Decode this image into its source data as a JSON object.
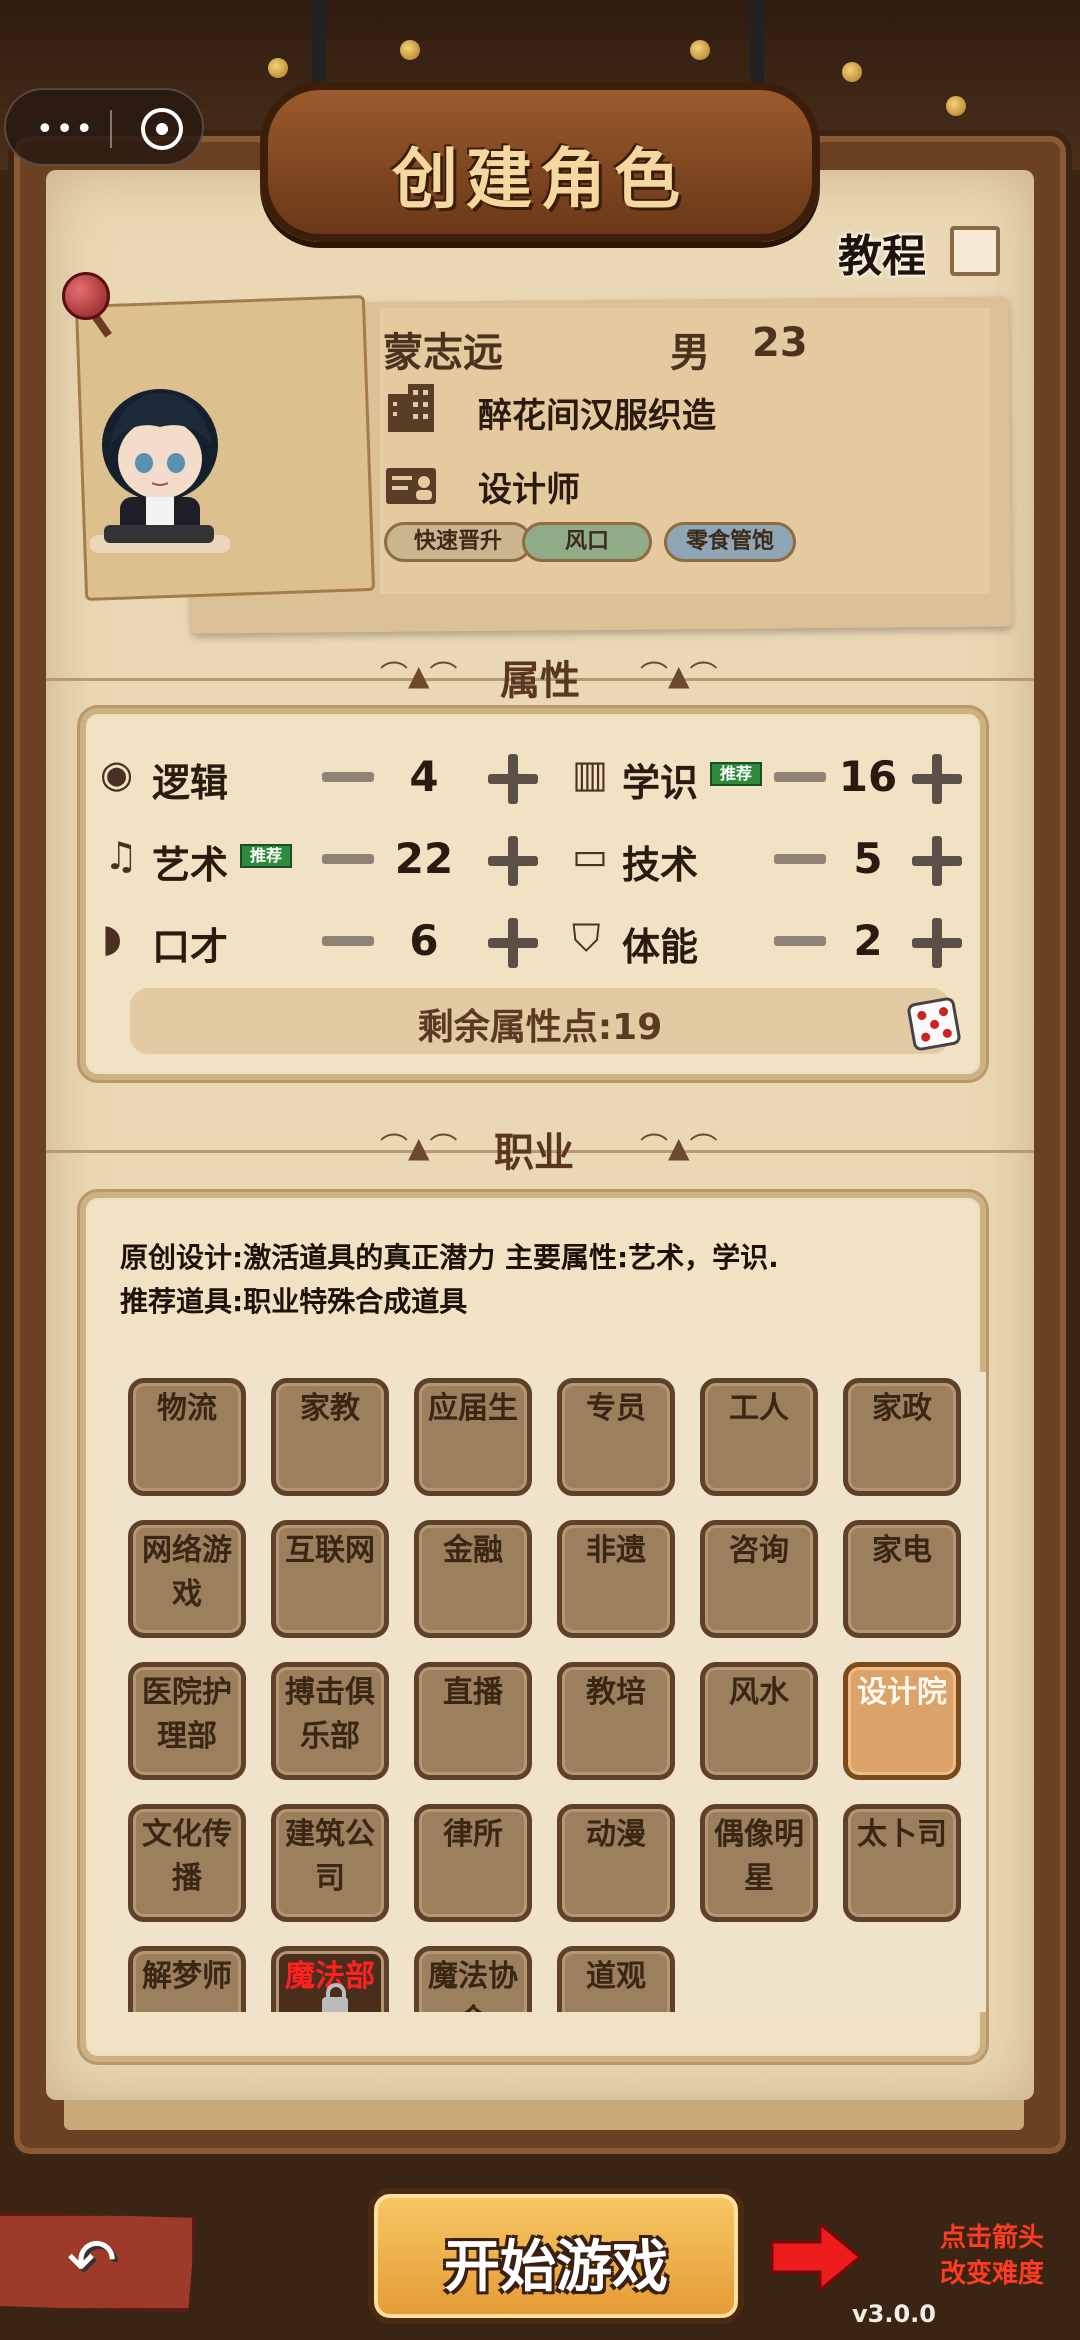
{
  "header": {
    "title": "创建角色",
    "tutorial_label": "教程",
    "tutorial_checked": false
  },
  "character": {
    "name": "蒙志远",
    "gender": "男",
    "age": "23",
    "company": "醉花间汉服织造",
    "job": "设计师",
    "tags": [
      {
        "label": "快速晋升",
        "color": "#c9b58e"
      },
      {
        "label": "风口",
        "color": "#8fab88"
      },
      {
        "label": "零食管饱",
        "color": "#8ea6b6"
      }
    ]
  },
  "attributes": {
    "section_title": "属性",
    "recommend_badge": "推荐",
    "items": [
      {
        "name": "逻辑",
        "icon": "brain-icon",
        "value": "4",
        "recommended": false
      },
      {
        "name": "学识",
        "icon": "book-icon",
        "value": "16",
        "recommended": true
      },
      {
        "name": "艺术",
        "icon": "music-note-icon",
        "value": "22",
        "recommended": true
      },
      {
        "name": "技术",
        "icon": "monitor-icon",
        "value": "5",
        "recommended": false
      },
      {
        "name": "口才",
        "icon": "lips-icon",
        "value": "6",
        "recommended": false
      },
      {
        "name": "体能",
        "icon": "shield-icon",
        "value": "2",
        "recommended": false
      }
    ],
    "remaining": "剩余属性点:19"
  },
  "profession": {
    "section_title": "职业",
    "description_line1": "原创设计:激活道具的真正潜力 主要属性:艺术，学识.",
    "description_line2": "推荐道具:职业特殊合成道具",
    "items": [
      {
        "label": "物流"
      },
      {
        "label": "家教"
      },
      {
        "label": "应届生"
      },
      {
        "label": "专员"
      },
      {
        "label": "工人"
      },
      {
        "label": "家政"
      },
      {
        "label": "网络游戏"
      },
      {
        "label": "互联网"
      },
      {
        "label": "金融"
      },
      {
        "label": "非遗"
      },
      {
        "label": "咨询"
      },
      {
        "label": "家电"
      },
      {
        "label": "医院护理部"
      },
      {
        "label": "搏击俱乐部"
      },
      {
        "label": "直播"
      },
      {
        "label": "教培"
      },
      {
        "label": "风水"
      },
      {
        "label": "设计院",
        "selected": true
      },
      {
        "label": "文化传播"
      },
      {
        "label": "建筑公司"
      },
      {
        "label": "律所"
      },
      {
        "label": "动漫"
      },
      {
        "label": "偶像明星"
      },
      {
        "label": "太卜司"
      },
      {
        "label": "解梦师"
      },
      {
        "label": "魔法部",
        "locked": true
      },
      {
        "label": "魔法协会"
      },
      {
        "label": "道观"
      }
    ]
  },
  "footer": {
    "start_label": "开始游戏",
    "hint_line1": "点击箭头",
    "hint_line2": "改变难度",
    "version": "v3.0.0"
  }
}
